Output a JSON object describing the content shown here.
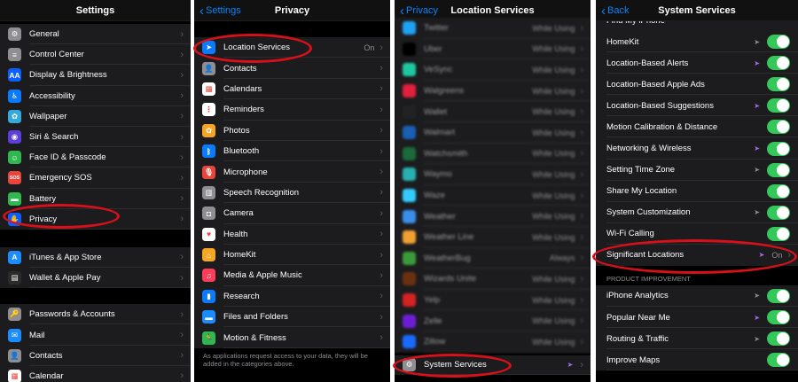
{
  "p1": {
    "title": "Settings",
    "group1": [
      {
        "label": "General",
        "color": "#8e8e93",
        "glyph": "⚙",
        "icon": "gear-icon"
      },
      {
        "label": "Control Center",
        "color": "#8e8e93",
        "glyph": "≡",
        "icon": "control-center-icon"
      },
      {
        "label": "Display & Brightness",
        "color": "#0a60ff",
        "glyph": "AA",
        "icon": "display-icon"
      },
      {
        "label": "Accessibility",
        "color": "#0a7aff",
        "glyph": "♿",
        "icon": "accessibility-icon"
      },
      {
        "label": "Wallpaper",
        "color": "#34aadc",
        "glyph": "✿",
        "icon": "wallpaper-icon"
      },
      {
        "label": "Siri & Search",
        "color": "#5b3fd6",
        "glyph": "◉",
        "icon": "siri-icon"
      },
      {
        "label": "Face ID & Passcode",
        "color": "#30b850",
        "glyph": "☺",
        "icon": "face-id-icon"
      },
      {
        "label": "Emergency SOS",
        "color": "#e8453c",
        "glyph": "SOS",
        "icon": "sos-icon"
      },
      {
        "label": "Battery",
        "color": "#30b850",
        "glyph": "▬",
        "icon": "battery-icon"
      },
      {
        "label": "Privacy",
        "color": "#0a60ff",
        "glyph": "✋",
        "icon": "privacy-hand-icon"
      }
    ],
    "group2": [
      {
        "label": "iTunes & App Store",
        "color": "#1a8cff",
        "glyph": "A",
        "icon": "app-store-icon"
      },
      {
        "label": "Wallet & Apple Pay",
        "color": "#2b2b2b",
        "glyph": "▤",
        "icon": "wallet-icon"
      }
    ],
    "group3": [
      {
        "label": "Passwords & Accounts",
        "color": "#8e8e93",
        "glyph": "🔑",
        "icon": "key-icon"
      },
      {
        "label": "Mail",
        "color": "#1a8cff",
        "glyph": "✉",
        "icon": "mail-icon"
      },
      {
        "label": "Contacts",
        "color": "#8e8e93",
        "glyph": "👤",
        "icon": "contacts-icon"
      },
      {
        "label": "Calendar",
        "color": "#ffffff",
        "glyph": "▦",
        "icon": "calendar-icon"
      }
    ]
  },
  "p2": {
    "title": "Privacy",
    "back": "Settings",
    "items": [
      {
        "label": "Location Services",
        "value": "On",
        "color": "#0a7aff",
        "glyph": "➤",
        "icon": "location-arrow-icon"
      },
      {
        "label": "Contacts",
        "color": "#8e8e93",
        "glyph": "👤",
        "icon": "contacts-icon"
      },
      {
        "label": "Calendars",
        "color": "#ffffff",
        "glyph": "▦",
        "icon": "calendar-icon"
      },
      {
        "label": "Reminders",
        "color": "#ffffff",
        "glyph": "⋮",
        "icon": "reminders-icon"
      },
      {
        "label": "Photos",
        "color": "#f5a623",
        "glyph": "✿",
        "icon": "photos-icon"
      },
      {
        "label": "Bluetooth",
        "color": "#0a7aff",
        "glyph": "ᛒ",
        "icon": "bluetooth-icon"
      },
      {
        "label": "Microphone",
        "color": "#e8453c",
        "glyph": "🎙",
        "icon": "microphone-icon"
      },
      {
        "label": "Speech Recognition",
        "color": "#8e8e93",
        "glyph": "▥",
        "icon": "speech-icon"
      },
      {
        "label": "Camera",
        "color": "#8e8e93",
        "glyph": "◘",
        "icon": "camera-icon"
      },
      {
        "label": "Health",
        "color": "#ffffff",
        "glyph": "♥",
        "icon": "health-heart-icon"
      },
      {
        "label": "HomeKit",
        "color": "#f5a623",
        "glyph": "⌂",
        "icon": "homekit-icon"
      },
      {
        "label": "Media & Apple Music",
        "color": "#fc3c58",
        "glyph": "♫",
        "icon": "music-icon"
      },
      {
        "label": "Research",
        "color": "#0a7aff",
        "glyph": "▮",
        "icon": "research-icon"
      },
      {
        "label": "Files and Folders",
        "color": "#1a8cff",
        "glyph": "▬",
        "icon": "folder-icon"
      },
      {
        "label": "Motion & Fitness",
        "color": "#30b850",
        "glyph": "🏃",
        "icon": "fitness-icon"
      }
    ],
    "footer": "As applications request access to your data, they will be added in the categories above."
  },
  "p3": {
    "title": "Location Services",
    "back": "Privacy",
    "apps": [
      {
        "label": "Twitter",
        "value": "While Using",
        "color": "#1da1f2"
      },
      {
        "label": "Uber",
        "value": "While Using",
        "color": "#000000"
      },
      {
        "label": "VeSync",
        "value": "While Using",
        "color": "#20c8a0"
      },
      {
        "label": "Walgreens",
        "value": "While Using",
        "color": "#e0203c"
      },
      {
        "label": "Wallet",
        "value": "While Using",
        "color": "#222222"
      },
      {
        "label": "Walmart",
        "value": "While Using",
        "color": "#1a5fb4"
      },
      {
        "label": "Watchsmith",
        "value": "While Using",
        "color": "#1a6a3a"
      },
      {
        "label": "Waymo",
        "value": "While Using",
        "color": "#28b0b0"
      },
      {
        "label": "Waze",
        "value": "While Using",
        "color": "#33ccff"
      },
      {
        "label": "Weather",
        "value": "While Using",
        "color": "#3a8eea"
      },
      {
        "label": "Weather Line",
        "value": "While Using",
        "color": "#f0a030"
      },
      {
        "label": "WeatherBug",
        "value": "Always",
        "color": "#3a9a3a"
      },
      {
        "label": "Wizards Unite",
        "value": "While Using",
        "color": "#6a3010"
      },
      {
        "label": "Yelp",
        "value": "While Using",
        "color": "#d32323"
      },
      {
        "label": "Zelle",
        "value": "While Using",
        "color": "#6d1ed4"
      },
      {
        "label": "Zillow",
        "value": "While Using",
        "color": "#1a6aff"
      }
    ],
    "system": {
      "label": "System Services",
      "color": "#8e8e93",
      "glyph": "⚙",
      "icon": "gear-icon"
    }
  },
  "p4": {
    "title": "System Services",
    "back": "Back",
    "top_partial": "Find My iPhone",
    "items": [
      {
        "label": "HomeKit",
        "arrow": "gray"
      },
      {
        "label": "Location-Based Alerts",
        "arrow": "purple"
      },
      {
        "label": "Location-Based Apple Ads",
        "arrow": "none"
      },
      {
        "label": "Location-Based Suggestions",
        "arrow": "purple"
      },
      {
        "label": "Motion Calibration & Distance",
        "arrow": "none"
      },
      {
        "label": "Networking & Wireless",
        "arrow": "purple"
      },
      {
        "label": "Setting Time Zone",
        "arrow": "gray"
      },
      {
        "label": "Share My Location",
        "arrow": "none"
      },
      {
        "label": "System Customization",
        "arrow": "gray"
      },
      {
        "label": "Wi-Fi Calling",
        "arrow": "none"
      }
    ],
    "significant": {
      "label": "Significant Locations",
      "value": "On"
    },
    "section_header": "PRODUCT IMPROVEMENT",
    "improvement": [
      {
        "label": "iPhone Analytics",
        "arrow": "gray"
      },
      {
        "label": "Popular Near Me",
        "arrow": "purple"
      },
      {
        "label": "Routing & Traffic",
        "arrow": "gray"
      },
      {
        "label": "Improve Maps",
        "arrow": "none"
      }
    ]
  },
  "colors": {
    "accent": "#0a84ff",
    "toggle_on": "#34c759",
    "highlight": "#d8101a",
    "location_arrow": "#a06ee8"
  }
}
